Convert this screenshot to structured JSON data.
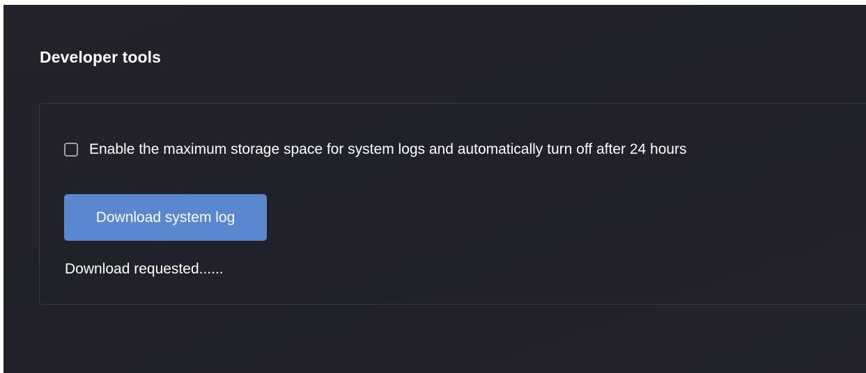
{
  "section": {
    "title": "Developer tools"
  },
  "log_settings": {
    "checkbox_label": "Enable the maximum storage space for system logs and automatically turn off after 24 hours",
    "checkbox_checked": false,
    "download_button_label": "Download system log",
    "status_text": "Download requested......"
  },
  "colors": {
    "background": "#21222a",
    "card_border": "#3a3b45",
    "button": "#5b87cf",
    "text": "#ffffff"
  }
}
